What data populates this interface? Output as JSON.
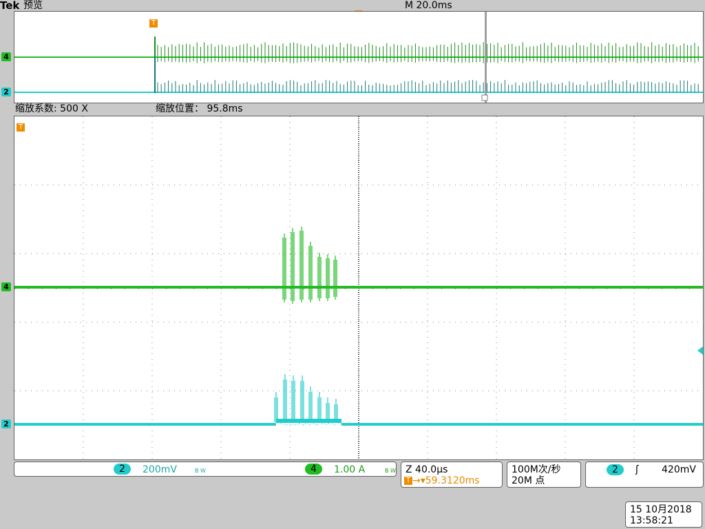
{
  "header": {
    "brand": "Tek",
    "mode": "预览",
    "timebase": "M 20.0ms"
  },
  "zoom": {
    "factor_label": "缩放系数: 500 X",
    "position_label": "缩放位置：  95.8ms"
  },
  "channels": {
    "ch2": {
      "marker": "2",
      "scale": "200mV",
      "bw": "B W",
      "color": "#22cccc"
    },
    "ch4": {
      "marker": "4",
      "scale": "1.00 A",
      "bw": "B W",
      "color": "#22bb22"
    }
  },
  "trigger_marker": "T",
  "zoom_panel": {
    "z_label": "Z 40.0µs",
    "trigger_pos": "59.3120ms"
  },
  "acquisition": {
    "rate": "100M次/秒",
    "points": "20M 点"
  },
  "trigger_panel": {
    "source": "2",
    "edge_symbol": "ʃ",
    "level": "420mV"
  },
  "datetime": {
    "date": "15 10月2018",
    "time": "13:58:21"
  },
  "grid_color": "#808080"
}
